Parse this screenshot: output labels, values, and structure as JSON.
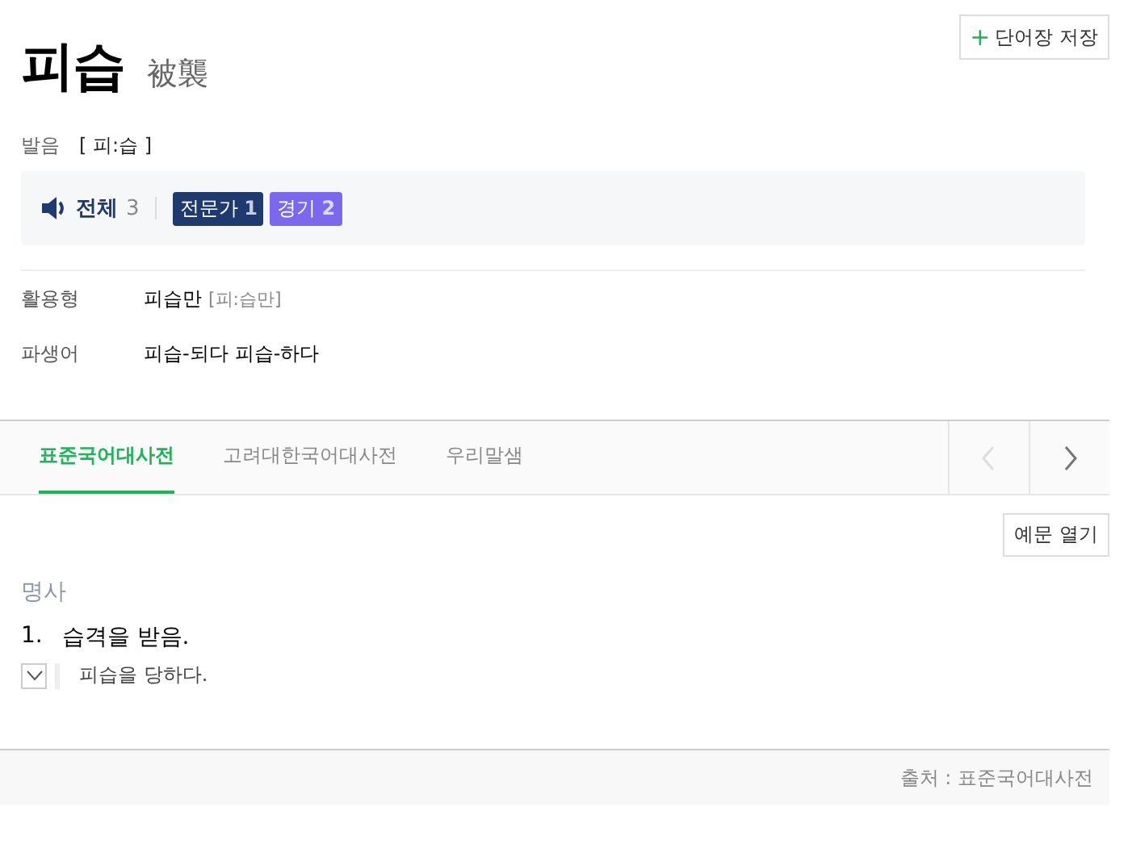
{
  "save_button": {
    "icon": "+",
    "label": "단어장 저장"
  },
  "headword": "피습",
  "hanja": "被襲",
  "pronunciation": {
    "label": "발음",
    "value": "[ 피:습 ]"
  },
  "audio": {
    "label": "전체",
    "count": "3",
    "tags": [
      {
        "label": "전문가",
        "count": "1",
        "color": "#1f3a6e"
      },
      {
        "label": "경기",
        "count": "2",
        "color": "#7b68ee"
      }
    ]
  },
  "forms": [
    {
      "label": "활용형",
      "values": [
        "피습만"
      ],
      "pron": "[피:습만]"
    },
    {
      "label": "파생어",
      "values": [
        "피습-되다",
        "피습-하다"
      ]
    }
  ],
  "tabs": [
    {
      "label": "표준국어대사전",
      "selected": true
    },
    {
      "label": "고려대한국어대사전",
      "selected": false
    },
    {
      "label": "우리말샘",
      "selected": false
    }
  ],
  "tab_nav": [
    {
      "kind": "prev",
      "disabled": true
    },
    {
      "kind": "next",
      "disabled": false
    }
  ],
  "examples_button": "예문 열기",
  "pos": "명사",
  "senses": [
    {
      "number": "1.",
      "text": "습격을 받음.",
      "example": "피습을 당하다.",
      "expanded": false
    }
  ],
  "source": "출처 : 표준국어대사전"
}
